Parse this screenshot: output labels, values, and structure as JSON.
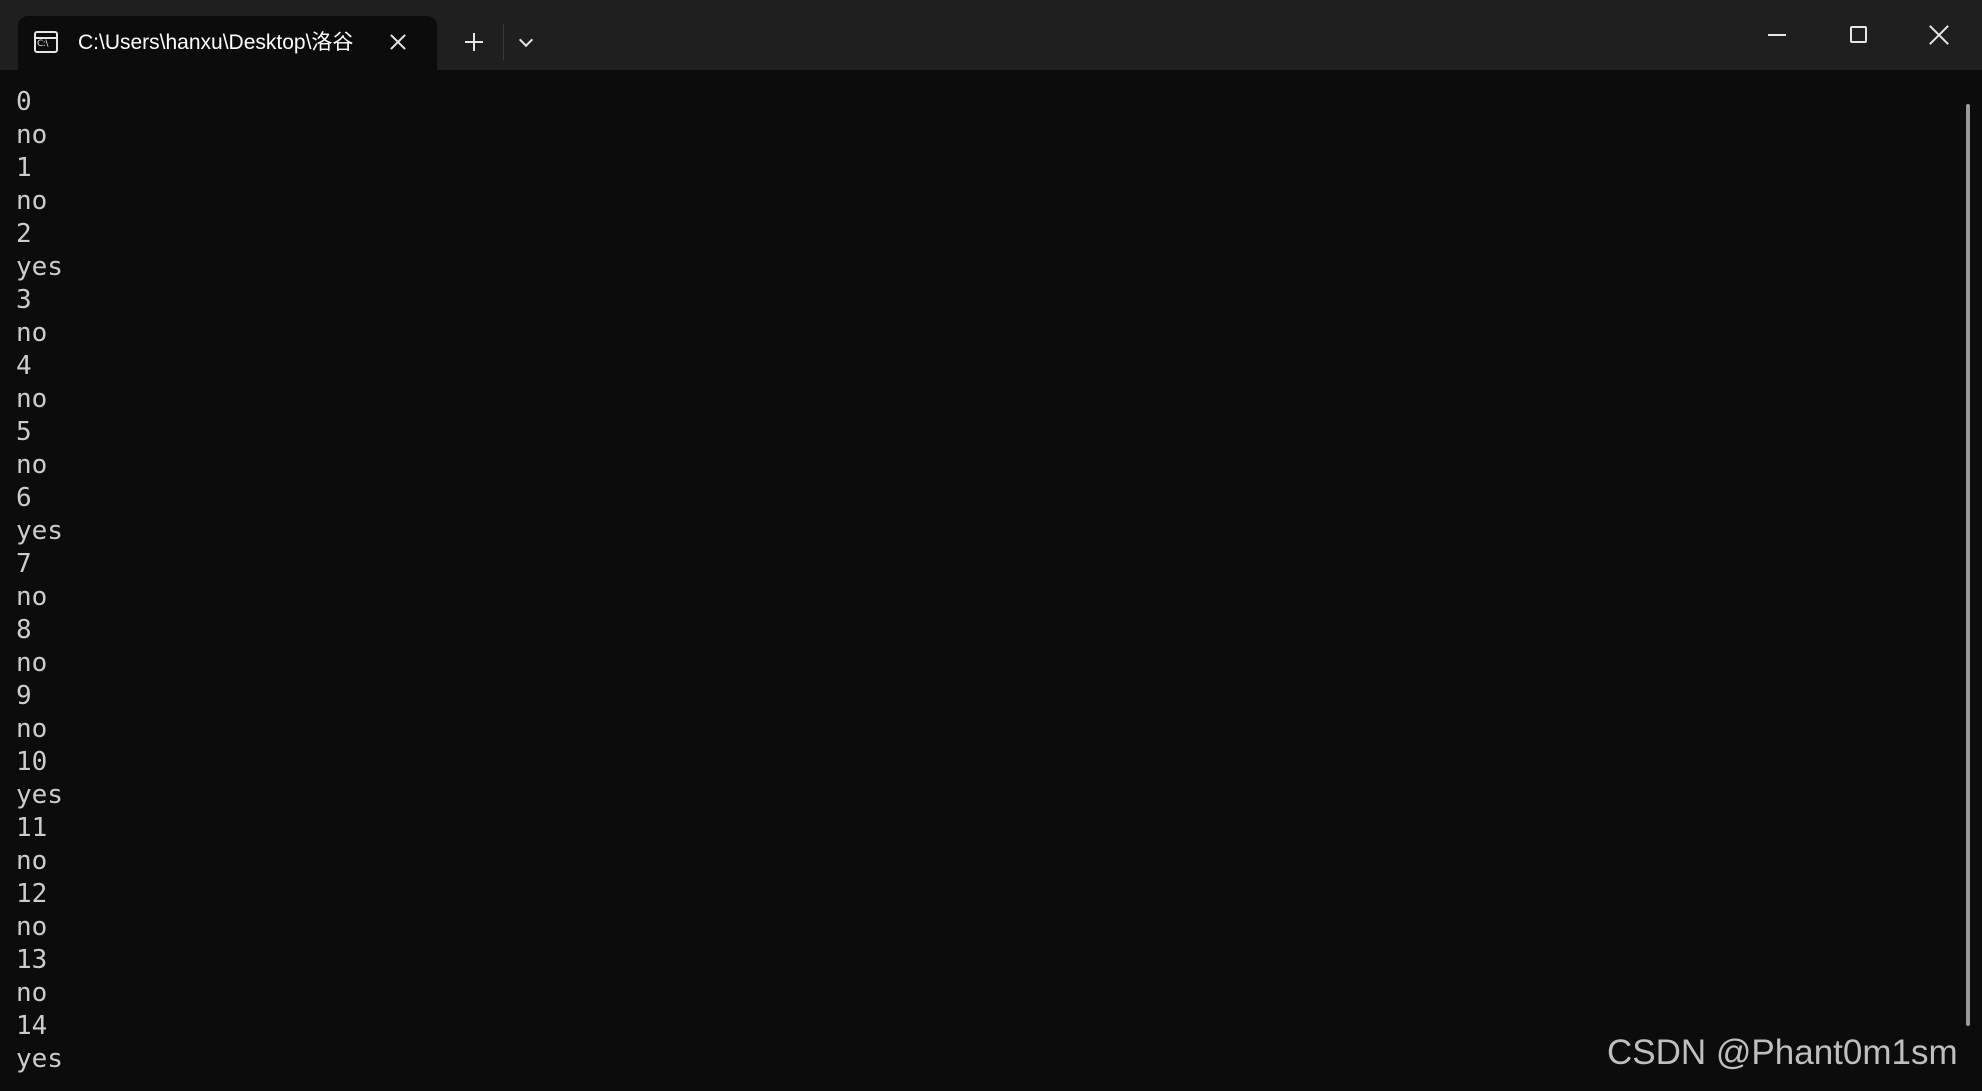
{
  "tab": {
    "icon": "terminal-icon",
    "icon_text": "C:\\",
    "title": "C:\\Users\\hanxu\\Desktop\\洛谷",
    "close_icon": "close-icon"
  },
  "tabstrip": {
    "new_tab_icon": "plus-icon",
    "dropdown_icon": "chevron-down-icon"
  },
  "window_controls": {
    "minimize_icon": "minimize-icon",
    "maximize_icon": "maximize-icon",
    "close_icon": "close-icon"
  },
  "terminal": {
    "lines": [
      "0",
      "no",
      "1",
      "no",
      "2",
      "yes",
      "3",
      "no",
      "4",
      "no",
      "5",
      "no",
      "6",
      "yes",
      "7",
      "no",
      "8",
      "no",
      "9",
      "no",
      "10",
      "yes",
      "11",
      "no",
      "12",
      "no",
      "13",
      "no",
      "14",
      "yes"
    ]
  },
  "watermark": "CSDN @Phant0m1sm",
  "colors": {
    "background": "#0c0c0c",
    "titlebar": "#1f1f1f",
    "text": "#cccccc"
  }
}
